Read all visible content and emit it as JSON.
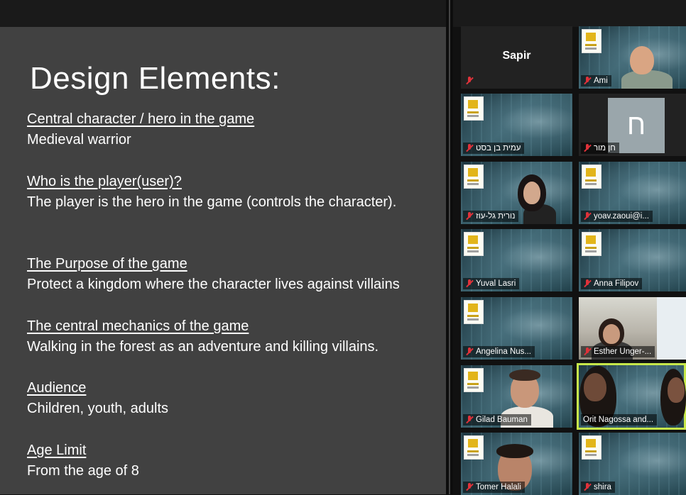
{
  "slide": {
    "title": "Design Elements:",
    "sections": [
      {
        "heading": "Central character / hero in the game",
        "text": "Medieval warrior"
      },
      {
        "heading": "Who is the player(user)?",
        "text": "The player is the hero in the game (controls the character)."
      },
      {
        "heading": "The Purpose of the game",
        "text": "Protect a kingdom where the character lives against villains"
      },
      {
        "heading": "The central mechanics of the game",
        "text": "Walking in the forest as an adventure and killing villains."
      },
      {
        "heading": "Audience",
        "text": "Children, youth, adults"
      },
      {
        "heading": "Age Limit ",
        "text": "From the age of 8"
      }
    ]
  },
  "participants": [
    {
      "name": "Sapir",
      "display": "name-only",
      "muted": true
    },
    {
      "name": "Ami",
      "display": "video",
      "muted": true
    },
    {
      "name": "עמית בן בסט",
      "display": "background",
      "muted": true
    },
    {
      "name": "חן מור",
      "display": "initial",
      "initial": "ח",
      "muted": true
    },
    {
      "name": "נורית גל-עוז",
      "display": "video",
      "muted": true
    },
    {
      "name": "yoav.zaoui@i...",
      "display": "background",
      "muted": true
    },
    {
      "name": "Yuval Lasri",
      "display": "background",
      "muted": true
    },
    {
      "name": "Anna Filipov",
      "display": "background",
      "muted": true
    },
    {
      "name": "Angelina Nus...",
      "display": "background",
      "muted": true
    },
    {
      "name": "Esther Unger-...",
      "display": "video",
      "muted": true
    },
    {
      "name": "Gilad Bauman",
      "display": "video",
      "muted": true
    },
    {
      "name": "Orit Nagossa and...",
      "display": "video",
      "muted": false,
      "speaking": true
    },
    {
      "name": "Tomer Halali",
      "display": "video",
      "muted": true
    },
    {
      "name": "shira",
      "display": "background",
      "muted": true
    }
  ],
  "colors": {
    "speaking_border": "#c7e84a",
    "muted_icon": "#e0323a",
    "slide_bg": "#414141"
  }
}
